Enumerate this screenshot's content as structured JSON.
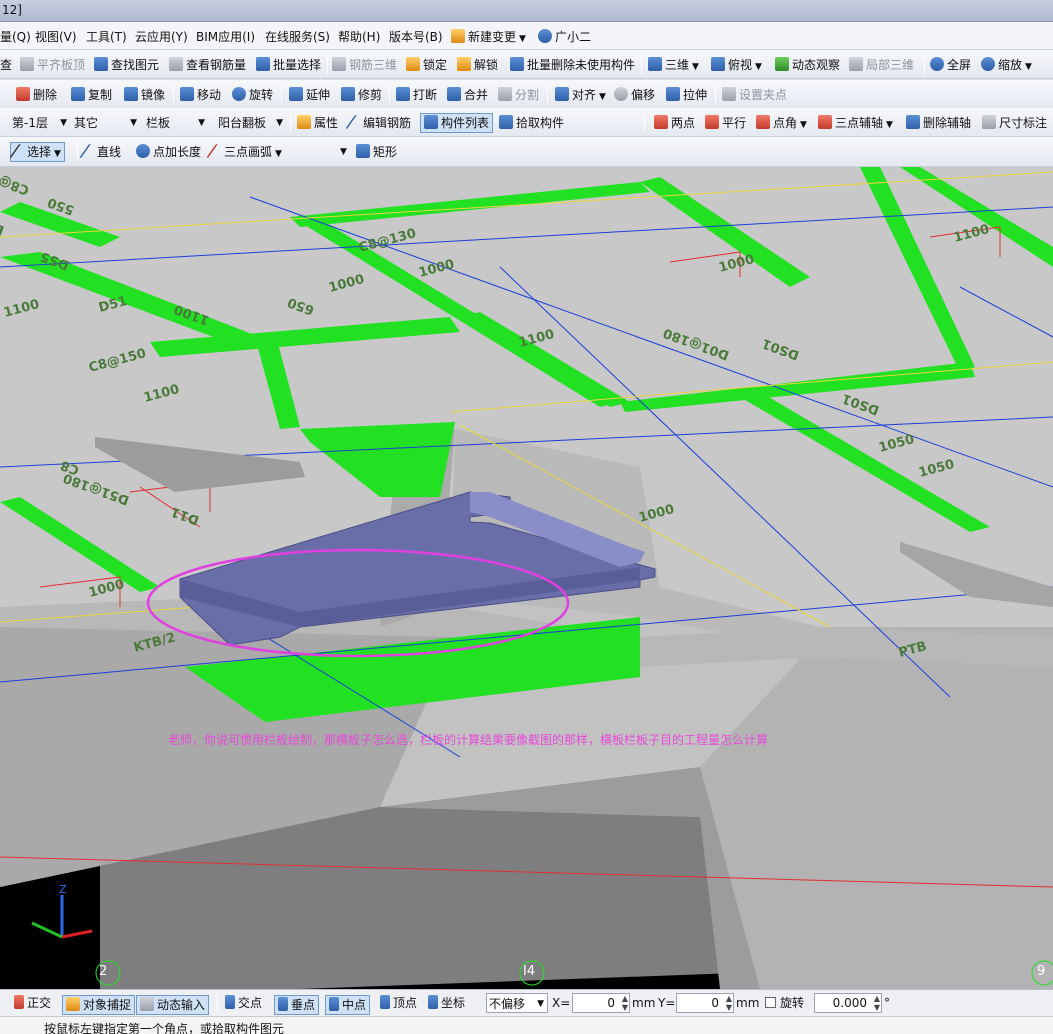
{
  "window": {
    "title_fragment": "12]"
  },
  "menubar": {
    "items": [
      "量(Q)",
      "视图(V)",
      "工具(T)",
      "云应用(Y)",
      "BIM应用(I)",
      "在线服务(S)",
      "帮助(H)",
      "版本号(B)"
    ],
    "new_change": "新建变更",
    "assistant": "广小二"
  },
  "toolbar1": {
    "items": [
      "查",
      "平齐板顶",
      "查找图元",
      "查看钢筋量",
      "批量选择",
      "钢筋三维",
      "锁定",
      "解锁",
      "批量删除未使用构件",
      "三维",
      "俯视",
      "动态观察",
      "局部三维",
      "全屏",
      "缩放"
    ]
  },
  "toolbar2": {
    "items": [
      "删除",
      "复制",
      "镜像",
      "移动",
      "旋转",
      "延伸",
      "修剪",
      "打断",
      "合并",
      "分割",
      "对齐",
      "偏移",
      "拉伸",
      "设置夹点"
    ]
  },
  "toolbar3": {
    "floor": "第-1层",
    "category": "其它",
    "type": "栏板",
    "component": "阳台翻板",
    "items": [
      "属性",
      "编辑钢筋",
      "构件列表",
      "拾取构件"
    ],
    "right_items": [
      "两点",
      "平行",
      "点角",
      "三点辅轴",
      "删除辅轴",
      "尺寸标注"
    ]
  },
  "toolbar4": {
    "items": [
      "选择",
      "直线",
      "点加长度",
      "三点画弧",
      "矩形"
    ]
  },
  "viewport": {
    "slab_labels": [
      "C8@150",
      "550",
      "D55",
      "DS5",
      "C8@130",
      "1000",
      "1100",
      "D51",
      "1000",
      "650",
      "1100",
      "C8@150",
      "1100",
      "D51@180",
      "C8",
      "DS01",
      "1000",
      "1050",
      "1050",
      "1000",
      "1100",
      "KTB/2",
      "D01@180",
      "1100",
      "D11",
      "DS01",
      "1000",
      "PTB"
    ],
    "question": "老师，你说可惯用栏板绘制，那横板子怎么选，栏板的计算结果要像截图的那样，横板栏板子目的工程量怎么计算",
    "axis_labels": [
      "2",
      "I4",
      "9"
    ],
    "colors": {
      "slab": "#c6c6c6",
      "beam": "#22e022",
      "ledge": "#6a6ea8",
      "highlight": "#e040e0",
      "grid_blue": "#1a3fd8",
      "grid_red": "#e03030",
      "grid_yellow": "#e8d640"
    }
  },
  "statusbar": {
    "items": [
      "正交",
      "对象捕捉",
      "动态输入",
      "交点",
      "垂点",
      "中点",
      "顶点",
      "坐标"
    ],
    "offset_mode": "不偏移",
    "x_label": "X=",
    "x_value": "0",
    "unit1": "mm",
    "y_label": "Y=",
    "y_value": "0",
    "unit2": "mm",
    "rotate_label": "旋转",
    "rotate_value": "0.000",
    "degree": "°"
  },
  "hint": "按鼠标左键指定第一个角点，或拾取构件图元"
}
